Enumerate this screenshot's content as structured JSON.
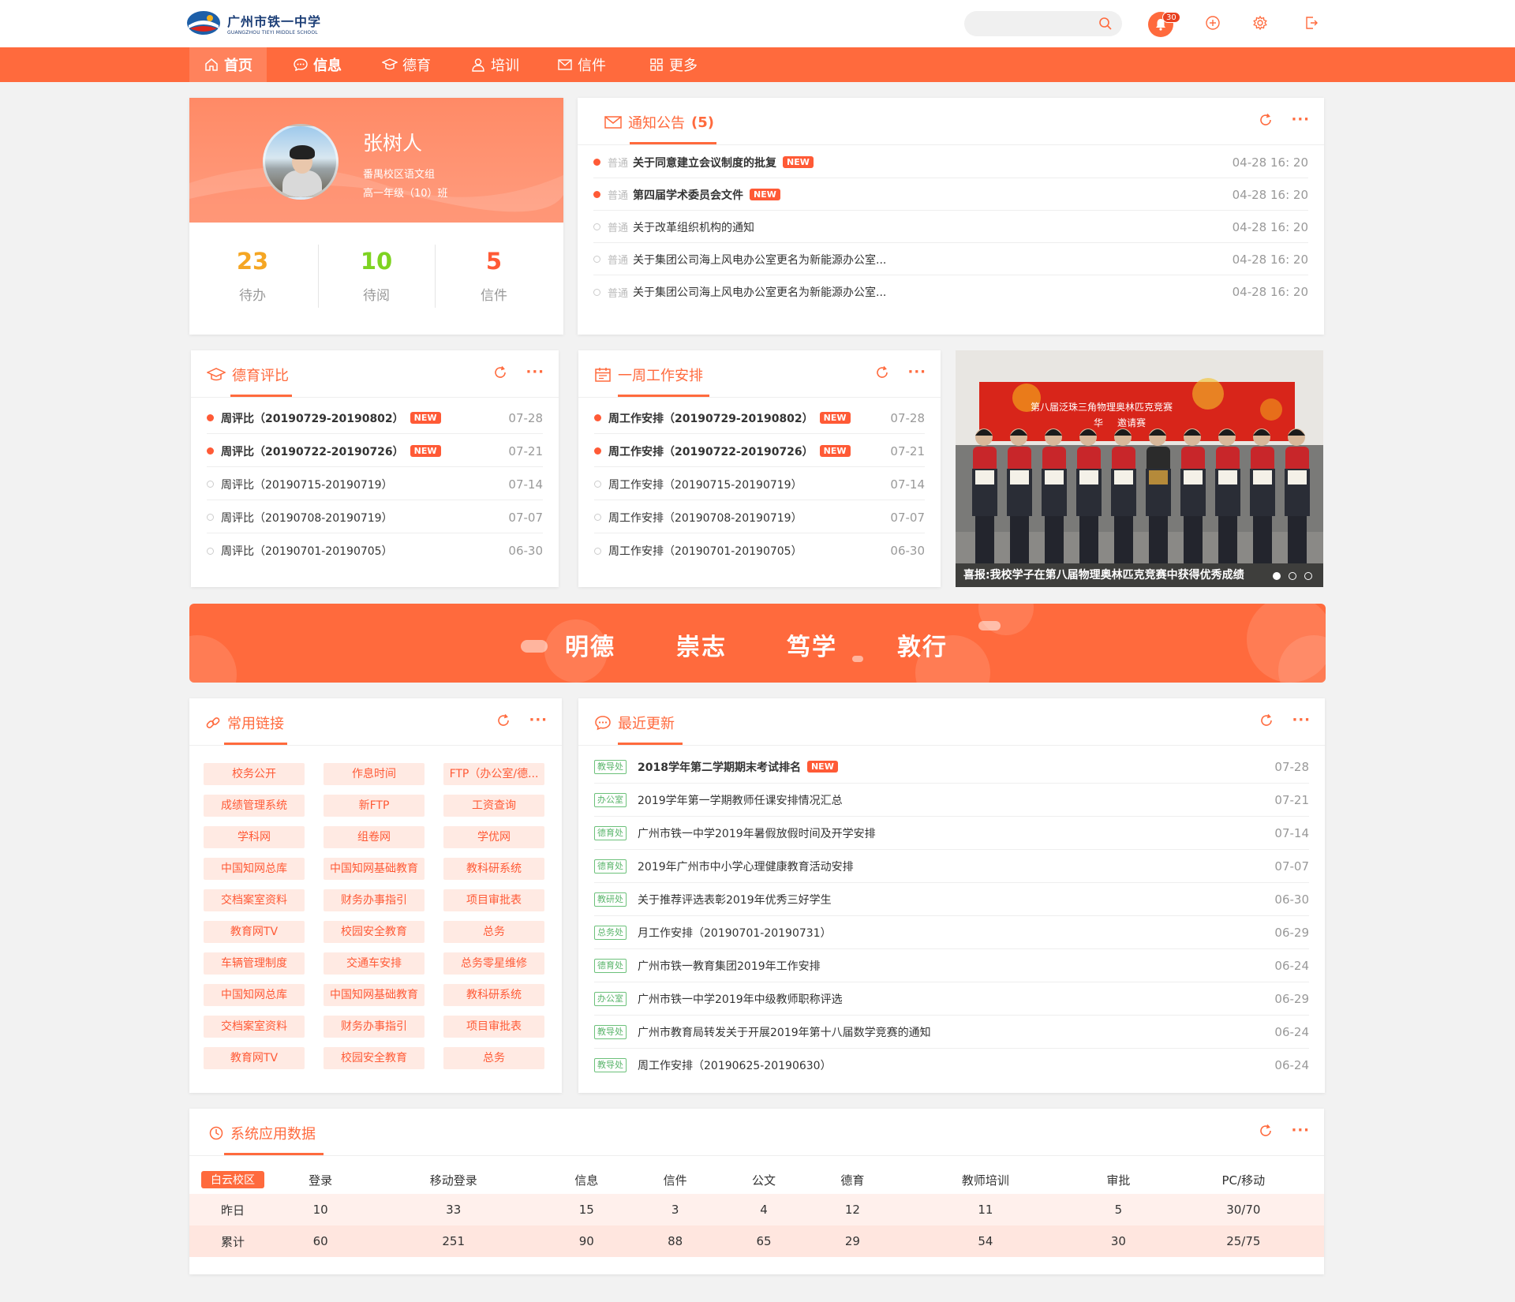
{
  "header": {
    "logo_cn": "广州市铁一中学",
    "logo_en": "GUANGZHOU TIEYI MIDDLE SCHOOL",
    "search_placeholder": "",
    "notification_count": "30",
    "icons": [
      "search-icon",
      "bell-icon",
      "add-icon",
      "settings-icon",
      "logout-icon"
    ]
  },
  "nav": [
    {
      "label": "首页",
      "icon": "home-icon",
      "active": true
    },
    {
      "label": "信息",
      "icon": "message-icon",
      "active": false
    },
    {
      "label": "德育",
      "icon": "graduation-icon",
      "active": false
    },
    {
      "label": "培训",
      "icon": "user-icon",
      "active": false
    },
    {
      "label": "信件",
      "icon": "mail-icon",
      "active": false
    },
    {
      "label": "更多",
      "icon": "grid-icon",
      "active": false
    }
  ],
  "profile": {
    "name": "张树人",
    "dept": "番禺校区语文组",
    "class": "高一年级（10）班",
    "stats": [
      {
        "value": "23",
        "label": "待办",
        "color": "#f5a623"
      },
      {
        "value": "10",
        "label": "待阅",
        "color": "#7ed321"
      },
      {
        "value": "5",
        "label": "信件",
        "color": "#ff5a36"
      }
    ]
  },
  "notices": {
    "title": "通知公告",
    "count": "(5)",
    "items": [
      {
        "tag": "普通",
        "text": "关于同意建立会议制度的批复",
        "new": true,
        "date": "04-28  16:  20",
        "unread": true
      },
      {
        "tag": "普通",
        "text": "第四届学术委员会文件",
        "new": true,
        "date": "04-28  16:  20",
        "unread": true
      },
      {
        "tag": "普通",
        "text": "关于改革组织机构的通知",
        "new": false,
        "date": "04-28  16:  20",
        "unread": false
      },
      {
        "tag": "普通",
        "text": "关于集团公司海上风电办公室更名为新能源办公室...",
        "new": false,
        "date": "04-28  16:  20",
        "unread": false
      },
      {
        "tag": "普通",
        "text": "关于集团公司海上风电办公室更名为新能源办公室...",
        "new": false,
        "date": "04-28  16:  20",
        "unread": false
      }
    ]
  },
  "moral": {
    "title": "德育评比",
    "items": [
      {
        "text": "周评比（20190729-20190802）",
        "new": true,
        "date": "07-28",
        "unread": true
      },
      {
        "text": "周评比（20190722-20190726）",
        "new": true,
        "date": "07-21",
        "unread": true
      },
      {
        "text": "周评比（20190715-20190719）",
        "new": false,
        "date": "07-14",
        "unread": false
      },
      {
        "text": "周评比（20190708-20190719）",
        "new": false,
        "date": "07-07",
        "unread": false
      },
      {
        "text": "周评比（20190701-20190705）",
        "new": false,
        "date": "06-30",
        "unread": false
      }
    ]
  },
  "weekly": {
    "title": "一周工作安排",
    "items": [
      {
        "text": "周工作安排（20190729-20190802）",
        "new": true,
        "date": "07-28",
        "unread": true
      },
      {
        "text": "周工作安排（20190722-20190726）",
        "new": true,
        "date": "07-21",
        "unread": true
      },
      {
        "text": "周工作安排（20190715-20190719）",
        "new": false,
        "date": "07-14",
        "unread": false
      },
      {
        "text": "周工作安排（20190708-20190719）",
        "new": false,
        "date": "07-07",
        "unread": false
      },
      {
        "text": "周工作安排（20190701-20190705）",
        "new": false,
        "date": "06-30",
        "unread": false
      }
    ]
  },
  "photo": {
    "caption": "喜报:我校学子在第八届物理奥林匹克竞赛中获得优秀成绩",
    "banner_text": "第八届泛珠三角物理奥林匹克竞赛",
    "banner_text2": "华",
    "banner_text3": "邀请赛",
    "slides": 3,
    "active_slide": 0
  },
  "motto": [
    "明德",
    "崇志",
    "笃学",
    "敦行"
  ],
  "links": {
    "title": "常用链接",
    "items": [
      "校务公开",
      "作息时间",
      "FTP（办公室/德...",
      "成绩管理系统",
      "新FTP",
      "工资查询",
      "学科网",
      "组卷网",
      "学优网",
      "中国知网总库",
      "中国知网基础教育",
      "教科研系统",
      "交档案室资料",
      "财务办事指引",
      "项目审批表",
      "教育网TV",
      "校园安全教育",
      "总务",
      "车辆管理制度",
      "交通车安排",
      "总务零星维修",
      "中国知网总库",
      "中国知网基础教育",
      "教科研系统",
      "交档案室资料",
      "财务办事指引",
      "项目审批表",
      "教育网TV",
      "校园安全教育",
      "总务"
    ]
  },
  "updates": {
    "title": "最近更新",
    "items": [
      {
        "cat": "教导处",
        "text": "2018学年第二学期期末考试排名",
        "new": true,
        "date": "07-28"
      },
      {
        "cat": "办公室",
        "text": "2019学年第一学期教师任课安排情况汇总",
        "new": false,
        "date": "07-21"
      },
      {
        "cat": "德育处",
        "text": "广州市铁一中学2019年暑假放假时间及开学安排",
        "new": false,
        "date": "07-14"
      },
      {
        "cat": "德育处",
        "text": "2019年广州市中小学心理健康教育活动安排",
        "new": false,
        "date": "07-07"
      },
      {
        "cat": "教研处",
        "text": "关于推荐评选表彰2019年优秀三好学生",
        "new": false,
        "date": "06-30"
      },
      {
        "cat": "总务处",
        "text": "月工作安排（20190701-20190731）",
        "new": false,
        "date": "06-29"
      },
      {
        "cat": "德育处",
        "text": "广州市铁一教育集团2019年工作安排",
        "new": false,
        "date": "06-24"
      },
      {
        "cat": "办公室",
        "text": "广州市铁一中学2019年中级教师职称评选",
        "new": false,
        "date": "06-29"
      },
      {
        "cat": "教导处",
        "text": "广州市教育局转发关于开展2019年第十八届数学竞赛的通知",
        "new": false,
        "date": "06-24"
      },
      {
        "cat": "教导处",
        "text": "周工作安排（20190625-20190630）",
        "new": false,
        "date": "06-24"
      }
    ]
  },
  "sysdata": {
    "title": "系统应用数据",
    "campus": "白云校区",
    "headers": [
      "登录",
      "移动登录",
      "信息",
      "信件",
      "公文",
      "德育",
      "教师培训",
      "审批",
      "PC/移动"
    ],
    "rows": [
      {
        "label": "昨日",
        "values": [
          "10",
          "33",
          "15",
          "3",
          "4",
          "12",
          "11",
          "5",
          "30/70"
        ]
      },
      {
        "label": "累计",
        "values": [
          "60",
          "251",
          "90",
          "88",
          "65",
          "29",
          "54",
          "30",
          "25/75"
        ]
      }
    ]
  },
  "new_label": "NEW",
  "colors": {
    "accent": "#ff6a3d",
    "new_badge": "#ff5a36",
    "link_bg": "#ffeae3",
    "cat_tag": "#5ab56b"
  }
}
